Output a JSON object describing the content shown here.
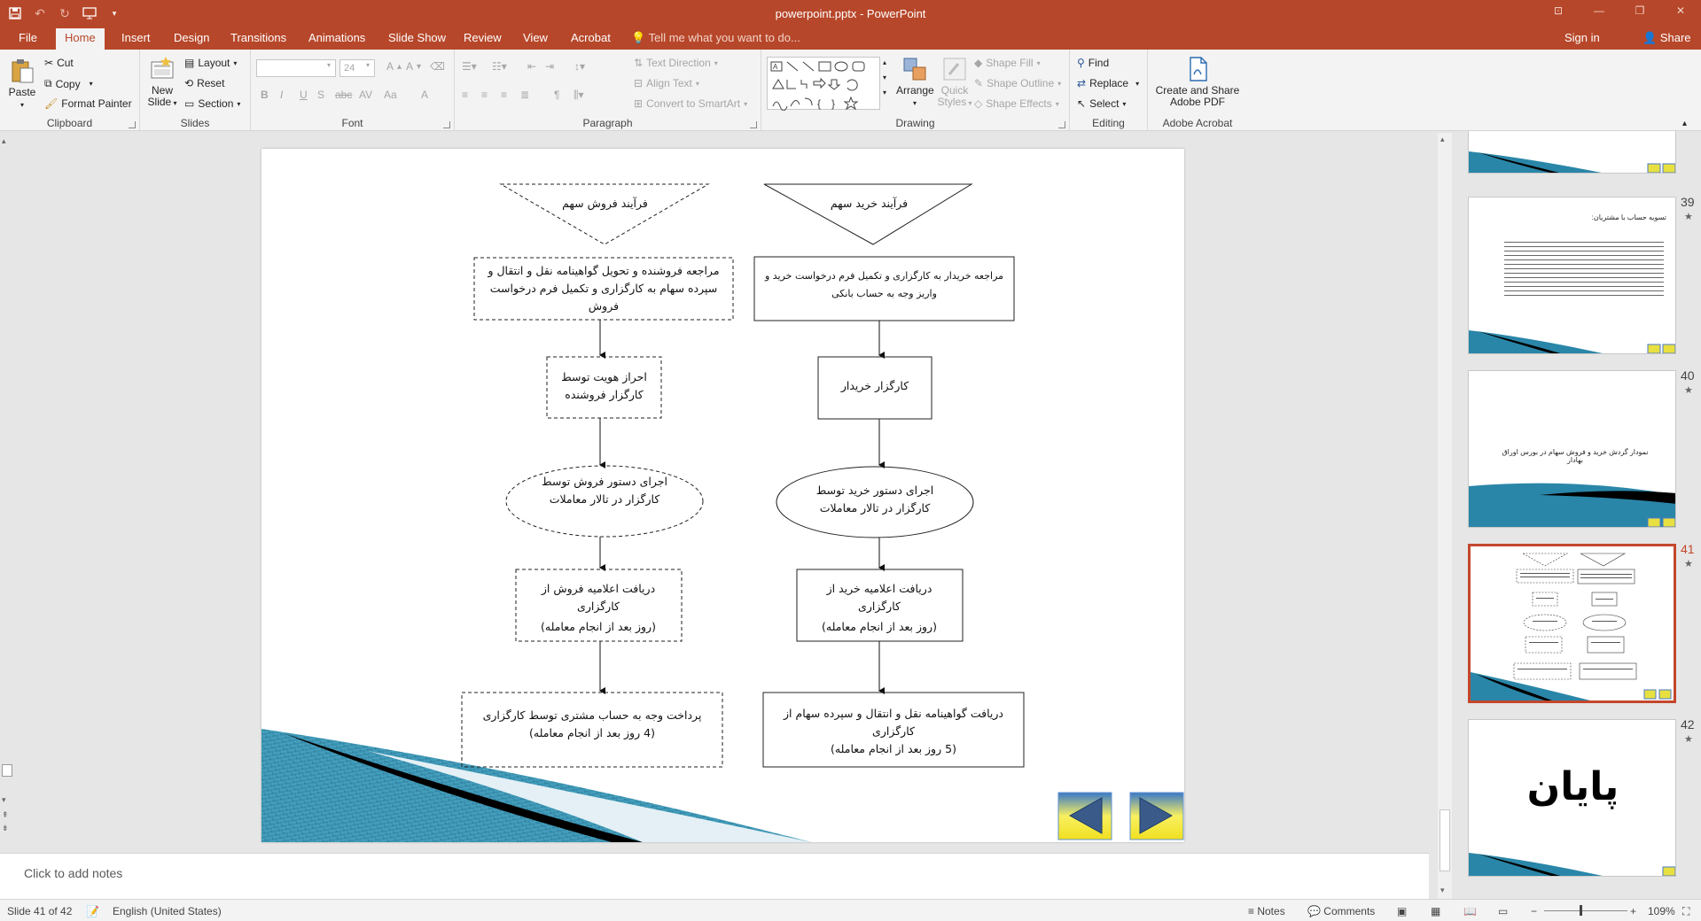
{
  "window": {
    "title": "powerpoint.pptx - PowerPoint"
  },
  "tabs": [
    "File",
    "Home",
    "Insert",
    "Design",
    "Transitions",
    "Animations",
    "Slide Show",
    "Review",
    "View",
    "Acrobat"
  ],
  "tell_me": "Tell me what you want to do...",
  "account": {
    "sign_in": "Sign in",
    "share": "Share"
  },
  "ribbon": {
    "clipboard": {
      "label": "Clipboard",
      "paste": "Paste",
      "cut": "Cut",
      "copy": "Copy",
      "format_painter": "Format Painter"
    },
    "slides": {
      "label": "Slides",
      "new_slide_1": "New",
      "new_slide_2": "Slide",
      "layout": "Layout",
      "reset": "Reset",
      "section": "Section"
    },
    "font": {
      "label": "Font",
      "font_size": "24"
    },
    "paragraph": {
      "label": "Paragraph",
      "text_direction": "Text Direction",
      "align_text": "Align Text",
      "convert_smartart": "Convert to SmartArt"
    },
    "drawing": {
      "label": "Drawing",
      "arrange": "Arrange",
      "quick_styles_1": "Quick",
      "quick_styles_2": "Styles",
      "shape_fill": "Shape Fill",
      "shape_outline": "Shape Outline",
      "shape_effects": "Shape Effects"
    },
    "editing": {
      "label": "Editing",
      "find": "Find",
      "replace": "Replace",
      "select": "Select"
    },
    "acrobat": {
      "label": "Adobe Acrobat",
      "create_share_1": "Create and Share",
      "create_share_2": "Adobe PDF"
    }
  },
  "slide": {
    "left_header": "فرآیند فروش سهم",
    "right_header": "فرآیند خرید سهم",
    "left_steps": [
      "مراجعه فروشنده و تحویل گواهینامه نقل و انتقال و سپرده سهام به کارگزاری و تکمیل فرم درخواست فروش",
      "احراز هویت توسط کارگزار فروشنده",
      "اجرای دستور فروش توسط کارگزار در تالار معاملات",
      "دریافت اعلامیه فروش از کارگزاری",
      "(روز بعد از انجام معامله)",
      "پرداخت وجه به حساب مشتری توسط کارگزاری",
      "(4 روز بعد از انجام معامله)"
    ],
    "right_steps": [
      "مراجعه خریدار به کارگزاری و تکمیل فرم درخواست خرید و واریز وجه به حساب بانکی",
      "کارگزار خریدار",
      "اجرای دستور خرید توسط کارگزار در تالار معاملات",
      "دریافت اعلامیه خرید از کارگزاری",
      "(روز بعد از انجام معامله)",
      "دریافت گواهینامه نقل و انتقال و سپرده سهام از کارگزاری",
      "(5 روز بعد از انجام معامله)"
    ]
  },
  "notes_placeholder": "Click to add notes",
  "thumbnails": [
    {
      "num": "39",
      "title": "تسویه حساب با مشتریان:"
    },
    {
      "num": "40",
      "title": "نمودار گردش خرید و فروش سهام در بورس اوراق بهادار"
    },
    {
      "num": "41",
      "title": ""
    },
    {
      "num": "42",
      "title": "پایان"
    }
  ],
  "status": {
    "slide_info": "Slide 41 of 42",
    "language": "English (United States)",
    "notes": "Notes",
    "comments": "Comments",
    "zoom": "109%"
  },
  "colors": {
    "accent": "#b7472a",
    "selected_thumb": "#c4472c"
  }
}
